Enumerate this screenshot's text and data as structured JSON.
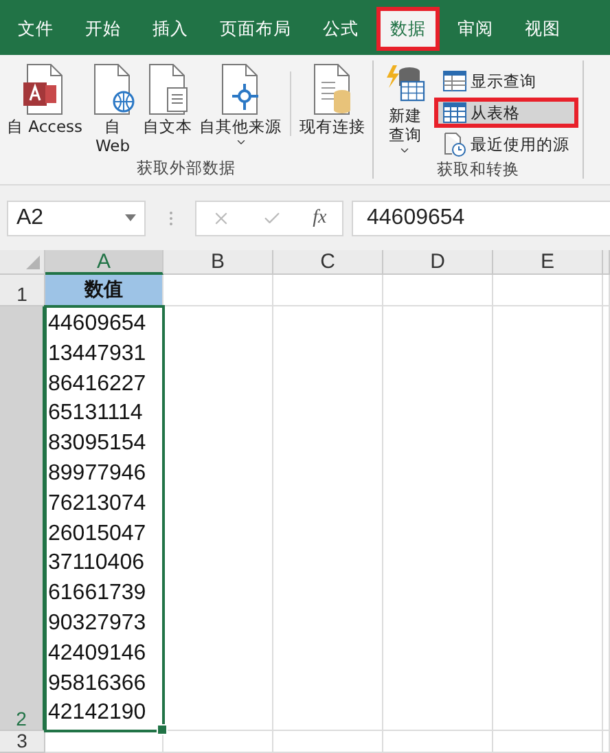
{
  "ribbon_tabs": [
    {
      "label": "文件",
      "selected": false,
      "highlighted": false
    },
    {
      "label": "开始",
      "selected": false,
      "highlighted": false
    },
    {
      "label": "插入",
      "selected": false,
      "highlighted": false
    },
    {
      "label": "页面布局",
      "selected": false,
      "highlighted": false
    },
    {
      "label": "公式",
      "selected": false,
      "highlighted": false
    },
    {
      "label": "数据",
      "selected": true,
      "highlighted": true
    },
    {
      "label": "审阅",
      "selected": false,
      "highlighted": false
    },
    {
      "label": "视图",
      "selected": false,
      "highlighted": false
    }
  ],
  "ribbon_groups": [
    {
      "label": "获取外部数据",
      "buttons": [
        {
          "kind": "large",
          "label": "自 Access",
          "dropdown": false
        },
        {
          "kind": "large",
          "label": "自\nWeb",
          "dropdown": false
        },
        {
          "kind": "large",
          "label": "自文本",
          "dropdown": false
        },
        {
          "kind": "large",
          "label": "自其他来源",
          "dropdown": true
        },
        {
          "kind": "separator"
        },
        {
          "kind": "large",
          "label": "现有连接",
          "dropdown": false
        }
      ]
    },
    {
      "label": "获取和转换",
      "buttons": [
        {
          "kind": "large",
          "label": "新建查询",
          "dropdown": true
        },
        {
          "kind": "small",
          "label": "显示查询",
          "highlighted": false
        },
        {
          "kind": "small",
          "label": "从表格",
          "highlighted": true
        },
        {
          "kind": "small",
          "label": "最近使用的源",
          "highlighted": false
        }
      ]
    }
  ],
  "formula_bar": {
    "name_box": "A2",
    "function_label": "fx",
    "formula": "44609654"
  },
  "sheet": {
    "columns": [
      {
        "label": "A",
        "selected": true
      },
      {
        "label": "B",
        "selected": false
      },
      {
        "label": "C",
        "selected": false
      },
      {
        "label": "D",
        "selected": false
      },
      {
        "label": "E",
        "selected": false
      }
    ],
    "rows": [
      {
        "label": "1",
        "selected": false,
        "kind": "header",
        "cells": [
          "数值"
        ]
      },
      {
        "label": "2",
        "selected": true,
        "kind": "data",
        "cells": [
          "44609654\n13447931\n86416227\n65131114\n83095154\n89977946\n76213074\n26015047\n37110406\n61661739\n90327973\n42409146\n95816366\n42142190"
        ]
      },
      {
        "label": "3",
        "selected": false,
        "kind": "empty"
      }
    ]
  }
}
